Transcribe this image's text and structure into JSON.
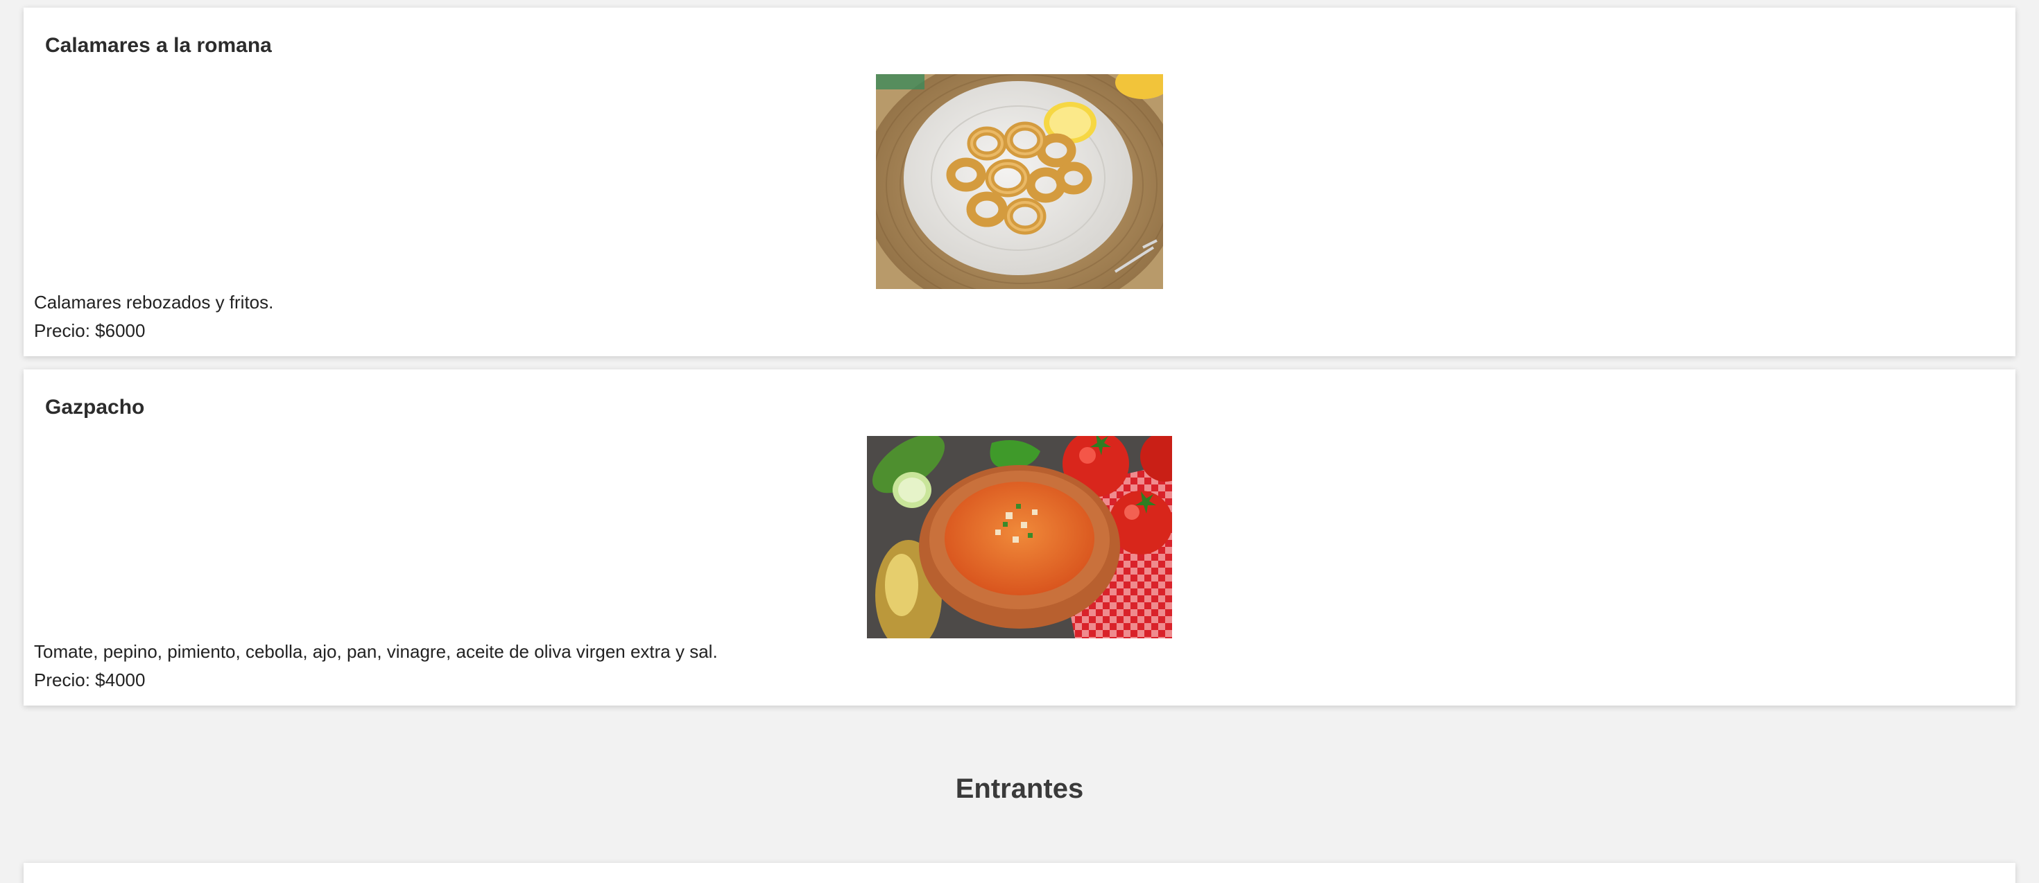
{
  "dishes": [
    {
      "name": "Calamares a la romana",
      "description": "Calamares rebozados y fritos.",
      "price": "Precio: $6000",
      "image_alt": "Calamares a la romana"
    },
    {
      "name": "Gazpacho",
      "description": "Tomate, pepino, pimiento, cebolla, ajo, pan, vinagre, aceite de oliva virgen extra y sal.",
      "price": "Precio: $4000",
      "image_alt": "Gazpacho"
    }
  ],
  "section": {
    "title": "Entrantes"
  },
  "colors": {
    "background": "#f2f2f2",
    "card": "#ffffff",
    "title_text": "#2c2c2c",
    "section_text": "#3a3a3a"
  }
}
